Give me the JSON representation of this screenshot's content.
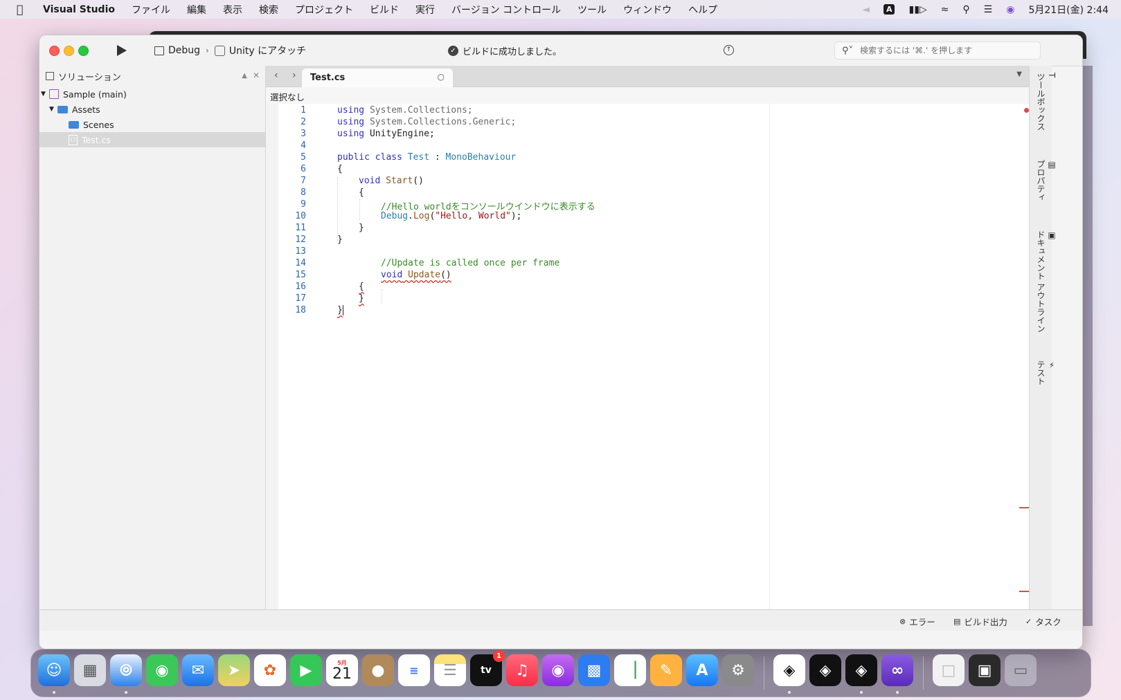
{
  "menubar": {
    "app_name": "Visual Studio",
    "items": [
      "ファイル",
      "編集",
      "表示",
      "検索",
      "プロジェクト",
      "ビルド",
      "実行",
      "バージョン コントロール",
      "ツール",
      "ウィンドウ",
      "ヘルプ"
    ],
    "clock": "5月21日(金) 2:44",
    "input_mode": "A"
  },
  "toolbar": {
    "config": "Debug",
    "target": "Unity にアタッチ",
    "status": "ビルドに成功しました。",
    "search_placeholder": "検索するには '⌘.' を押します"
  },
  "solution_pad": {
    "title": "ソリューション",
    "tree": [
      {
        "label": "Sample (main)",
        "type": "solution"
      },
      {
        "label": "Assets",
        "type": "folder"
      },
      {
        "label": "Scenes",
        "type": "folder"
      },
      {
        "label": "Test.cs",
        "type": "file",
        "selected": true
      }
    ]
  },
  "editor": {
    "tab": "Test.cs",
    "breadcrumb": "選択なし",
    "lines": [
      "1",
      "2",
      "3",
      "4",
      "5",
      "6",
      "7",
      "8",
      "9",
      "10",
      "11",
      "12",
      "13",
      "14",
      "15",
      "16",
      "17",
      "18"
    ],
    "code": {
      "l1_kw": "using",
      "l1_ns": "System.Collections;",
      "l2_kw": "using",
      "l2_ns": "System.Collections.Generic;",
      "l3_kw": "using",
      "l3_ns": "UnityEngine;",
      "l5_kw": "public class",
      "l5_ty": "Test",
      "l5_sep": ":",
      "l5_base": "MonoBehaviour",
      "l6": "{",
      "l7_kw": "void",
      "l7_fn": "Start",
      "l7_p": "()",
      "l8": "{",
      "l9": "//Hello worldをコンソールウインドウに表示する",
      "l10_ty": "Debug",
      "l10_dot": ".",
      "l10_fn": "Log",
      "l10_o": "(",
      "l10_str": "\"Hello, World\"",
      "l10_c": ");",
      "l11": "}",
      "l12": "}",
      "l14": "//Update is called once per frame",
      "l15_kw": "void",
      "l15_fn": "Update",
      "l15_p": "()",
      "l16": "{",
      "l17": "}",
      "l18": "}"
    }
  },
  "right_pads": [
    "ツールボックス",
    "プロパティ",
    "ドキュメント アウトライン",
    "テスト"
  ],
  "statusbar": {
    "errors": "エラー",
    "build_output": "ビルド出力",
    "tasks": "タスク"
  },
  "dock": {
    "apps": [
      "finder",
      "launchpad",
      "safari",
      "messages",
      "mail",
      "maps",
      "photos",
      "facetime",
      "calendar",
      "contacts",
      "reminders",
      "notes",
      "tv",
      "music",
      "podcasts",
      "keynote",
      "numbers",
      "pages",
      "app-store",
      "system-preferences",
      "unity",
      "unity",
      "unity",
      "visual-studio",
      "document",
      "screenshot",
      "trash"
    ],
    "calendar_month": "5月",
    "calendar_day": "21",
    "tv_badge": "1",
    "tv_label": "tv"
  }
}
